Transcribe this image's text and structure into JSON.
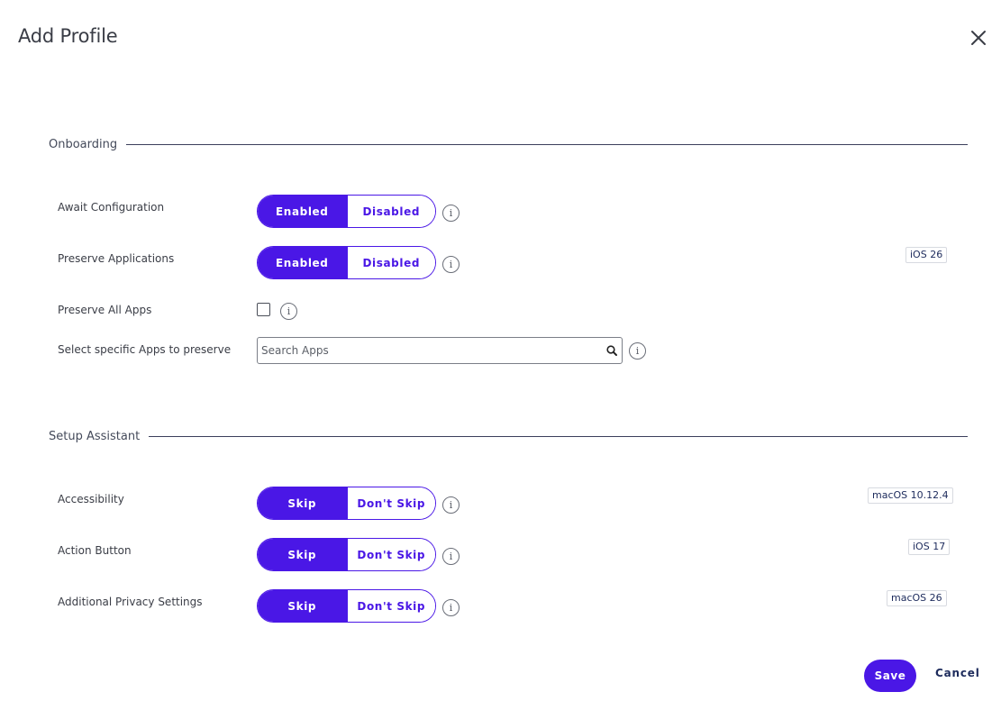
{
  "dialog": {
    "title": "Add Profile"
  },
  "sections": {
    "onboarding": {
      "title": "Onboarding"
    },
    "setup_assistant": {
      "title": "Setup Assistant"
    }
  },
  "onboarding": {
    "await_configuration": {
      "label": "Await Configuration",
      "on": "Enabled",
      "off": "Disabled",
      "selected": "Enabled"
    },
    "preserve_applications": {
      "label": "Preserve Applications",
      "on": "Enabled",
      "off": "Disabled",
      "selected": "Enabled",
      "badge": "iOS 26"
    },
    "preserve_all_apps": {
      "label": "Preserve All Apps",
      "checked": false
    },
    "select_apps": {
      "label": "Select specific Apps to preserve",
      "placeholder": "Search Apps",
      "value": ""
    }
  },
  "setup_assistant": {
    "accessibility": {
      "label": "Accessibility",
      "on": "Skip",
      "off": "Don't Skip",
      "selected": "Skip",
      "badge": "macOS 10.12.4"
    },
    "action_button": {
      "label": "Action Button",
      "on": "Skip",
      "off": "Don't Skip",
      "selected": "Skip",
      "badge": "iOS 17"
    },
    "additional_privacy": {
      "label": "Additional Privacy Settings",
      "on": "Skip",
      "off": "Don't Skip",
      "selected": "Skip",
      "badge": "macOS 26"
    }
  },
  "footer": {
    "save_label": "Save",
    "cancel_label": "Cancel"
  },
  "info_glyph": "i",
  "colors": {
    "accent": "#4a17e6",
    "badge_text": "#1d2b5c",
    "divider": "#3b3f5c"
  },
  "icons": {
    "close": "close-icon",
    "info": "info-icon",
    "search": "search-icon"
  }
}
